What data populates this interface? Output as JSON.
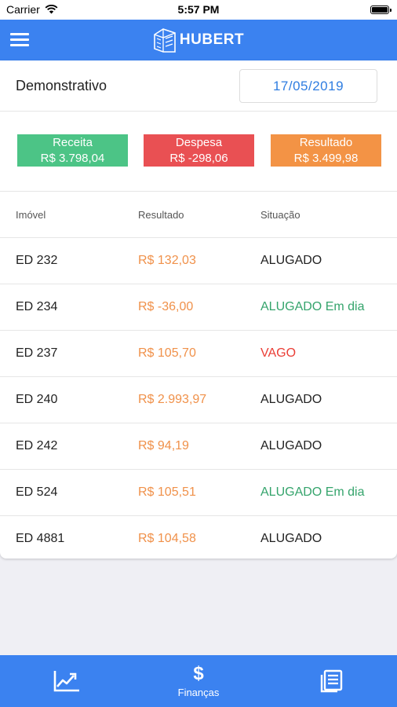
{
  "status": {
    "carrier": "Carrier",
    "time": "5:57 PM"
  },
  "header": {
    "app_name": "HUBERT"
  },
  "demo": {
    "title": "Demonstrativo",
    "date": "17/05/2019"
  },
  "summary": [
    {
      "label": "Receita",
      "value": "R$ 3.798,04",
      "color": "#4cc486"
    },
    {
      "label": "Despesa",
      "value": "R$ -298,06",
      "color": "#e95053"
    },
    {
      "label": "Resultado",
      "value": "R$ 3.499,98",
      "color": "#f39345"
    }
  ],
  "table": {
    "headers": [
      "Imóvel",
      "Resultado",
      "Situação"
    ],
    "rows": [
      {
        "imovel": "ED 232",
        "resultado": "R$ 132,03",
        "situacao": "ALUGADO",
        "status_color": "#222222"
      },
      {
        "imovel": "ED 234",
        "resultado": "R$ -36,00",
        "situacao": "ALUGADO Em dia",
        "status_color": "#35a46c"
      },
      {
        "imovel": "ED 237",
        "resultado": "R$ 105,70",
        "situacao": "VAGO",
        "status_color": "#ea3d35"
      },
      {
        "imovel": "ED 240",
        "resultado": "R$ 2.993,97",
        "situacao": "ALUGADO",
        "status_color": "#222222"
      },
      {
        "imovel": "ED 242",
        "resultado": "R$ 94,19",
        "situacao": "ALUGADO",
        "status_color": "#222222"
      },
      {
        "imovel": "ED 524",
        "resultado": "R$ 105,51",
        "situacao": "ALUGADO Em dia",
        "status_color": "#35a46c"
      },
      {
        "imovel": "ED 4881",
        "resultado": "R$ 104,58",
        "situacao": "ALUGADO",
        "status_color": "#222222"
      }
    ]
  },
  "tabbar": {
    "tabs": [
      {
        "icon": "chart-line-icon",
        "label": ""
      },
      {
        "icon": "dollar-icon",
        "label": "Finanças"
      },
      {
        "icon": "document-list-icon",
        "label": ""
      }
    ]
  },
  "colors": {
    "primary": "#3b82f0",
    "date_text": "#2f7de1",
    "amount": "#f0914a"
  }
}
